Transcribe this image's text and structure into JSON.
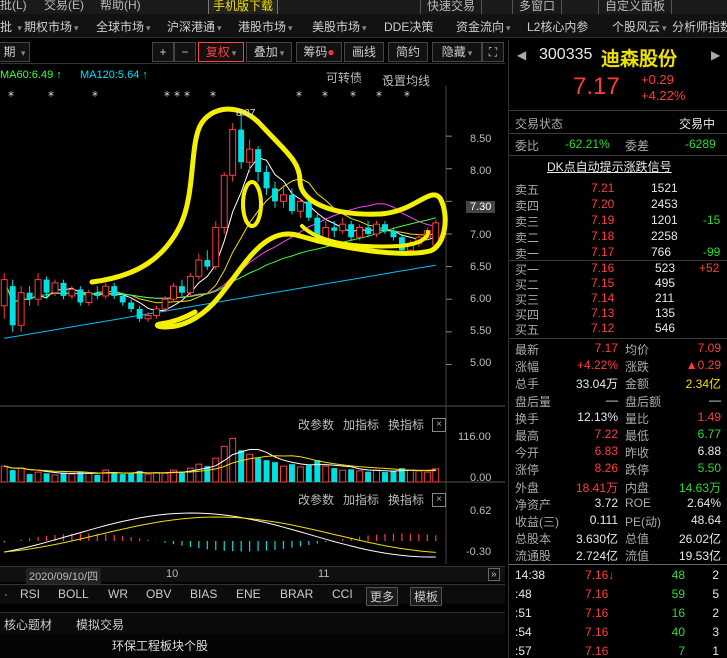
{
  "top_menu": [
    "批(L)",
    "交易(E)",
    "帮助(H)",
    "手机版下载",
    "快速交易",
    "多窗口",
    "自定义面板"
  ],
  "menu": [
    {
      "label": "期权市场"
    },
    {
      "label": "全球市场"
    },
    {
      "label": "沪深港通"
    },
    {
      "label": "港股市场"
    },
    {
      "label": "美股市场"
    },
    {
      "label": "DDE决策"
    },
    {
      "label": "资金流向"
    },
    {
      "label": "L2核心内参"
    },
    {
      "label": "个股风云"
    },
    {
      "label": "分析师指数"
    }
  ],
  "toolbar": {
    "period": "期",
    "plus": "+",
    "minus": "−",
    "fuquan": "复权",
    "overlay": "叠加",
    "chip": "筹码",
    "draw": "画线",
    "simple": "简约",
    "hide": "隐藏"
  },
  "ma_line": {
    "ma60": "MA60:6.49 ↑",
    "ma120": "MA120:5.64 ↑",
    "convertible": "可转债",
    "set_ma": "设置均线"
  },
  "price_axis": {
    "ticks": [
      "8.50",
      "8.00",
      "7.50",
      "7.00",
      "6.50",
      "6.00",
      "5.50",
      "5.00"
    ],
    "current_tag": "7.30",
    "high_label": "8.87"
  },
  "sub1": {
    "params": "改参数",
    "add": "加指标",
    "switch": "换指标",
    "close": "×",
    "axis_top": "116.00",
    "axis_bottom": "0.00"
  },
  "sub2": {
    "params": "改参数",
    "add": "加指标",
    "switch": "换指标",
    "close": "×",
    "axis_top": "0.62",
    "axis_bottom": "-0.30"
  },
  "date_bar": {
    "date": "2020/09/10/四",
    "m10": "10",
    "m11": "11"
  },
  "indicator_tabs": [
    "RSI",
    "BOLL",
    "WR",
    "OBV",
    "BIAS",
    "ENE",
    "BRAR",
    "CCI",
    "更多",
    "模板"
  ],
  "bottom1": {
    "a": "核心题材",
    "b": "模拟交易"
  },
  "bottom2": {
    "title": "环保工程板块个股"
  },
  "stock": {
    "code": "300335",
    "name": "迪森股份",
    "price": "7.17",
    "change": "+0.29",
    "pct": "+4.22%",
    "trade_status_label": "交易状态",
    "trade_status": "交易中",
    "weibi_label": "委比",
    "weibi": "-62.21%",
    "weicha_label": "委差",
    "weicha": "-6289",
    "dk_signal": "DK点自动提示涨跌信号"
  },
  "asks": [
    {
      "label": "卖五",
      "price": "7.21",
      "vol": "1521",
      "chg": ""
    },
    {
      "label": "卖四",
      "price": "7.20",
      "vol": "2453",
      "chg": ""
    },
    {
      "label": "卖三",
      "price": "7.19",
      "vol": "1201",
      "chg": "-15"
    },
    {
      "label": "卖二",
      "price": "7.18",
      "vol": "2258",
      "chg": ""
    },
    {
      "label": "卖一",
      "price": "7.17",
      "vol": "766",
      "chg": "-99"
    }
  ],
  "bids": [
    {
      "label": "买一",
      "price": "7.16",
      "vol": "523",
      "chg": "+52"
    },
    {
      "label": "买二",
      "price": "7.15",
      "vol": "495",
      "chg": ""
    },
    {
      "label": "买三",
      "price": "7.14",
      "vol": "211",
      "chg": ""
    },
    {
      "label": "买四",
      "price": "7.13",
      "vol": "135",
      "chg": ""
    },
    {
      "label": "买五",
      "price": "7.12",
      "vol": "546",
      "chg": ""
    }
  ],
  "stats": [
    {
      "l1": "最新",
      "v1": "7.17",
      "c1": "red",
      "l2": "均价",
      "v2": "7.09",
      "c2": "red"
    },
    {
      "l1": "涨幅",
      "v1": "+4.22%",
      "c1": "red",
      "l2": "涨跌",
      "v2": "▲0.29",
      "c2": "red"
    },
    {
      "l1": "总手",
      "v1": "33.04万",
      "c1": "white",
      "l2": "金额",
      "v2": "2.34亿",
      "c2": "yellow"
    },
    {
      "l1": "盘后量",
      "v1": "—",
      "c1": "white",
      "l2": "盘后额",
      "v2": "—",
      "c2": "white"
    },
    {
      "l1": "换手",
      "v1": "12.13%",
      "c1": "white",
      "l2": "量比",
      "v2": "1.49",
      "c2": "red"
    },
    {
      "l1": "最高",
      "v1": "7.22",
      "c1": "red",
      "l2": "最低",
      "v2": "6.77",
      "c2": "green"
    },
    {
      "l1": "今开",
      "v1": "6.83",
      "c1": "red",
      "l2": "昨收",
      "v2": "6.88",
      "c2": "white"
    },
    {
      "l1": "涨停",
      "v1": "8.26",
      "c1": "red",
      "l2": "跌停",
      "v2": "5.50",
      "c2": "green"
    },
    {
      "l1": "外盘",
      "v1": "18.41万",
      "c1": "red",
      "l2": "内盘",
      "v2": "14.63万",
      "c2": "green"
    },
    {
      "l1": "净资产",
      "v1": "3.72",
      "c1": "white",
      "l2": "ROE",
      "v2": "2.64%",
      "c2": "white"
    },
    {
      "l1": "收益(三)",
      "v1": "0.111",
      "c1": "white",
      "l2": "PE(动)",
      "v2": "48.64",
      "c2": "white"
    },
    {
      "l1": "总股本",
      "v1": "3.630亿",
      "c1": "white",
      "l2": "总值",
      "v2": "26.02亿",
      "c2": "white"
    },
    {
      "l1": "流通股",
      "v1": "2.724亿",
      "c1": "white",
      "l2": "流值",
      "v2": "19.53亿",
      "c2": "white"
    }
  ],
  "ticks": [
    {
      "time": "14:38",
      "price": "7.16↓",
      "vol": "48",
      "n": "2",
      "vc": "green"
    },
    {
      "time": ":48",
      "price": "7.16",
      "vol": "59",
      "n": "5",
      "vc": "green"
    },
    {
      "time": ":51",
      "price": "7.16",
      "vol": "16",
      "n": "2",
      "vc": "green"
    },
    {
      "time": ":54",
      "price": "7.16",
      "vol": "40",
      "n": "3",
      "vc": "green"
    },
    {
      "time": ":57",
      "price": "7.16",
      "vol": "7",
      "n": "1",
      "vc": "green"
    }
  ],
  "colors": {
    "up": "#ff3c3c",
    "down": "#00e0e0",
    "ma5": "#ffffff",
    "ma10": "#f0e000",
    "ma20": "#ff40ff",
    "ma30": "#40ff40",
    "annotation": "#f5f000"
  },
  "candles": [
    {
      "o": 5.9,
      "c": 6.3,
      "h": 6.4,
      "l": 5.7
    },
    {
      "o": 6.2,
      "c": 5.6,
      "h": 6.3,
      "l": 5.5
    },
    {
      "o": 5.6,
      "c": 6.1,
      "h": 6.2,
      "l": 5.5
    },
    {
      "o": 6.1,
      "c": 6.0,
      "h": 6.2,
      "l": 5.9
    },
    {
      "o": 6.0,
      "c": 6.3,
      "h": 6.4,
      "l": 5.9
    },
    {
      "o": 6.3,
      "c": 6.1,
      "h": 6.35,
      "l": 6.0
    },
    {
      "o": 6.1,
      "c": 6.25,
      "h": 6.3,
      "l": 6.05
    },
    {
      "o": 6.25,
      "c": 6.05,
      "h": 6.3,
      "l": 6.0
    },
    {
      "o": 6.05,
      "c": 6.15,
      "h": 6.2,
      "l": 6.0
    },
    {
      "o": 6.15,
      "c": 5.95,
      "h": 6.2,
      "l": 5.9
    },
    {
      "o": 5.95,
      "c": 6.1,
      "h": 6.15,
      "l": 5.9
    },
    {
      "o": 6.1,
      "c": 6.05,
      "h": 6.2,
      "l": 6.0
    },
    {
      "o": 6.05,
      "c": 6.2,
      "h": 6.25,
      "l": 6.0
    },
    {
      "o": 6.2,
      "c": 6.05,
      "h": 6.25,
      "l": 6.0
    },
    {
      "o": 6.05,
      "c": 5.95,
      "h": 6.1,
      "l": 5.9
    },
    {
      "o": 5.95,
      "c": 5.85,
      "h": 6.0,
      "l": 5.8
    },
    {
      "o": 5.85,
      "c": 5.7,
      "h": 5.9,
      "l": 5.65
    },
    {
      "o": 5.7,
      "c": 5.75,
      "h": 5.8,
      "l": 5.65
    },
    {
      "o": 5.75,
      "c": 5.85,
      "h": 5.9,
      "l": 5.7
    },
    {
      "o": 5.85,
      "c": 6.0,
      "h": 6.05,
      "l": 5.8
    },
    {
      "o": 6.0,
      "c": 6.2,
      "h": 6.25,
      "l": 5.95
    },
    {
      "o": 6.2,
      "c": 6.1,
      "h": 6.3,
      "l": 6.05
    },
    {
      "o": 6.1,
      "c": 6.35,
      "h": 6.4,
      "l": 6.05
    },
    {
      "o": 6.35,
      "c": 6.6,
      "h": 6.7,
      "l": 6.3
    },
    {
      "o": 6.6,
      "c": 6.5,
      "h": 6.75,
      "l": 6.45
    },
    {
      "o": 6.5,
      "c": 7.1,
      "h": 7.2,
      "l": 6.45
    },
    {
      "o": 7.1,
      "c": 7.9,
      "h": 7.95,
      "l": 7.0
    },
    {
      "o": 7.9,
      "c": 8.6,
      "h": 8.7,
      "l": 7.8
    },
    {
      "o": 8.6,
      "c": 8.1,
      "h": 8.87,
      "l": 8.0
    },
    {
      "o": 8.1,
      "c": 8.3,
      "h": 8.45,
      "l": 7.95
    },
    {
      "o": 8.3,
      "c": 7.95,
      "h": 8.35,
      "l": 7.8
    },
    {
      "o": 7.95,
      "c": 7.7,
      "h": 8.05,
      "l": 7.6
    },
    {
      "o": 7.7,
      "c": 7.5,
      "h": 7.8,
      "l": 7.4
    },
    {
      "o": 7.5,
      "c": 7.6,
      "h": 7.75,
      "l": 7.4
    },
    {
      "o": 7.6,
      "c": 7.35,
      "h": 7.7,
      "l": 7.3
    },
    {
      "o": 7.35,
      "c": 7.5,
      "h": 7.55,
      "l": 7.25
    },
    {
      "o": 7.5,
      "c": 7.25,
      "h": 7.55,
      "l": 7.2
    },
    {
      "o": 7.25,
      "c": 6.9,
      "h": 7.3,
      "l": 6.85
    },
    {
      "o": 6.9,
      "c": 7.1,
      "h": 7.2,
      "l": 6.85
    },
    {
      "o": 7.1,
      "c": 7.05,
      "h": 7.2,
      "l": 6.95
    },
    {
      "o": 7.05,
      "c": 7.15,
      "h": 7.25,
      "l": 7.0
    },
    {
      "o": 7.15,
      "c": 6.95,
      "h": 7.2,
      "l": 6.9
    },
    {
      "o": 6.95,
      "c": 7.1,
      "h": 7.15,
      "l": 6.9
    },
    {
      "o": 7.1,
      "c": 7.0,
      "h": 7.2,
      "l": 6.95
    },
    {
      "o": 7.0,
      "c": 7.15,
      "h": 7.2,
      "l": 6.95
    },
    {
      "o": 7.15,
      "c": 7.05,
      "h": 7.2,
      "l": 7.0
    },
    {
      "o": 7.05,
      "c": 6.95,
      "h": 7.1,
      "l": 6.9
    },
    {
      "o": 6.95,
      "c": 6.75,
      "h": 7.0,
      "l": 6.7
    },
    {
      "o": 6.75,
      "c": 6.85,
      "h": 6.9,
      "l": 6.7
    },
    {
      "o": 6.85,
      "c": 6.95,
      "h": 7.0,
      "l": 6.8
    },
    {
      "o": 6.95,
      "c": 7.05,
      "h": 7.1,
      "l": 6.9
    },
    {
      "o": 6.83,
      "c": 7.17,
      "h": 7.22,
      "l": 6.77
    }
  ],
  "volumes": [
    40,
    30,
    35,
    20,
    25,
    22,
    18,
    24,
    20,
    26,
    22,
    18,
    30,
    24,
    20,
    22,
    28,
    20,
    24,
    22,
    30,
    26,
    35,
    45,
    40,
    60,
    90,
    110,
    80,
    70,
    60,
    55,
    50,
    40,
    45,
    38,
    42,
    55,
    40,
    35,
    30,
    32,
    28,
    26,
    30,
    25,
    28,
    35,
    30,
    28,
    25,
    33
  ]
}
